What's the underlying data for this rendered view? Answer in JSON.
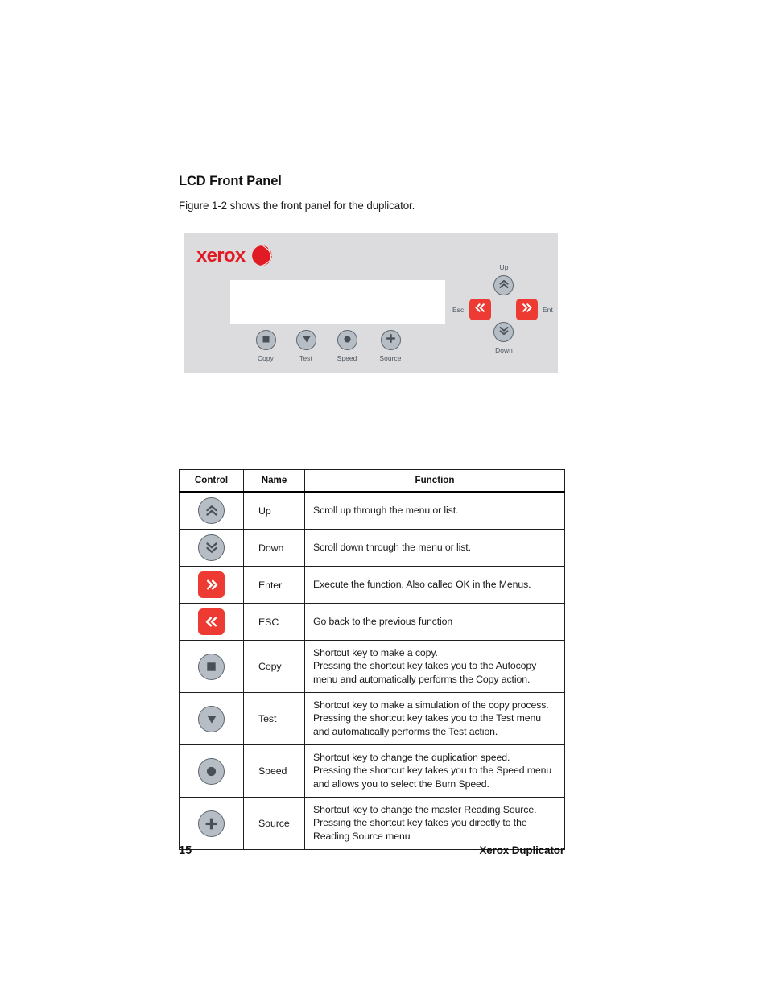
{
  "section": {
    "title": "LCD Front Panel",
    "intro": "Figure 1-2 shows the front panel for the duplicator."
  },
  "figure": {
    "brand": "xerox",
    "brand_color": "#e01b24",
    "panel_color": "#dcdcde",
    "button_gray": "#b7bdc4",
    "button_red": "#ed3b33",
    "lcd_value": "",
    "nav": {
      "up_label": "Up",
      "down_label": "Down",
      "esc_label": "Esc",
      "ent_label": "Ent"
    },
    "shortcuts": [
      {
        "label": "Copy",
        "icon": "square-icon"
      },
      {
        "label": "Test",
        "icon": "triangle-down-icon"
      },
      {
        "label": "Speed",
        "icon": "circle-filled-icon"
      },
      {
        "label": "Source",
        "icon": "plus-icon"
      }
    ]
  },
  "table": {
    "headers": [
      "Control",
      "Name",
      "Function"
    ],
    "rows": [
      {
        "icon": "chevron-double-up-icon",
        "name": "Up",
        "function": "Scroll up through the menu or list."
      },
      {
        "icon": "chevron-double-down-icon",
        "name": "Down",
        "function": "Scroll down through the menu or list."
      },
      {
        "icon": "chevron-double-right-icon",
        "name": "Enter",
        "function": "Execute the function. Also called OK in the Menus."
      },
      {
        "icon": "chevron-double-left-icon",
        "name": "ESC",
        "function": "Go back to the previous function"
      },
      {
        "icon": "square-icon",
        "name": "Copy",
        "function": "Shortcut key to make a copy.\nPressing the shortcut key takes you to the Autocopy menu and automatically performs the Copy action."
      },
      {
        "icon": "triangle-down-icon",
        "name": "Test",
        "function": "Shortcut key to make a simulation of the copy process.\nPressing the shortcut key takes you to the Test menu and automatically performs the Test action."
      },
      {
        "icon": "circle-filled-icon",
        "name": "Speed",
        "function": "Shortcut key to change the duplication speed.\nPressing the shortcut key takes you to the Speed menu and allows you to select the Burn Speed."
      },
      {
        "icon": "plus-icon",
        "name": "Source",
        "function": "Shortcut key to change the master Reading Source.\nPressing the shortcut key takes you directly to the Reading Source menu"
      }
    ]
  },
  "footer": {
    "page_number": "15",
    "document_title": "Xerox Duplicator"
  }
}
